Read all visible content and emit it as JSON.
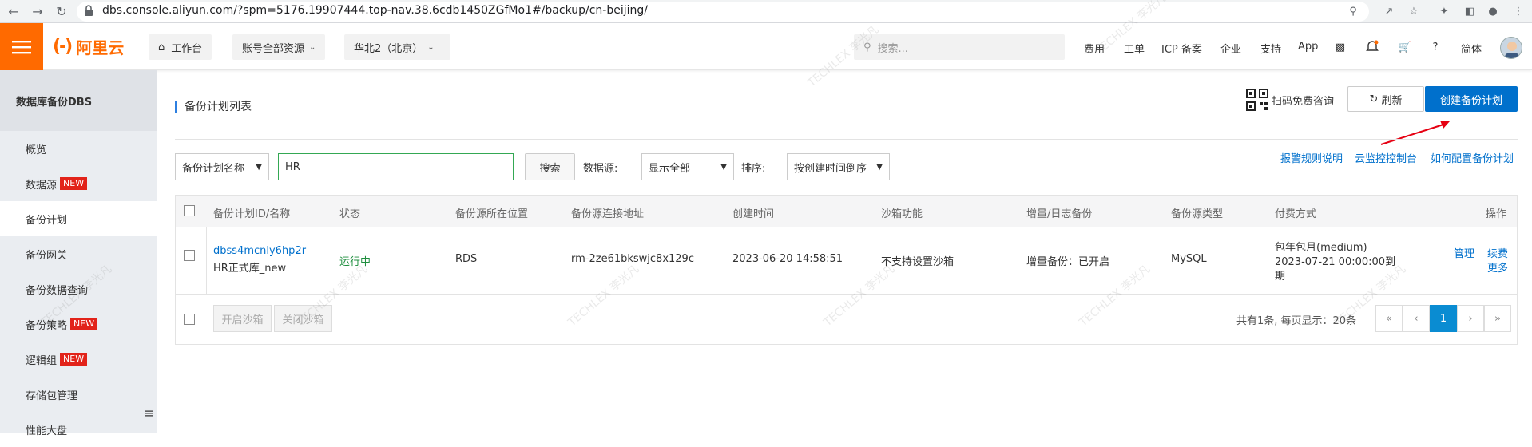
{
  "browser": {
    "url": "dbs.console.aliyun.com/?spm=5176.19907444.top-nav.38.6cdb1450ZGfMo1#/backup/cn-beijing/"
  },
  "topnav": {
    "logo_text": "阿里云",
    "logo_mark": "(-)",
    "workbench": "工作台",
    "account_resources": "账号全部资源",
    "region": "华北2（北京）",
    "search_placeholder": "搜索...",
    "links": [
      "费用",
      "工单",
      "ICP 备案",
      "企业",
      "支持",
      "App"
    ],
    "lang": "简体"
  },
  "sidebar": {
    "title": "数据库备份DBS",
    "items": [
      {
        "label": "概览",
        "badge": ""
      },
      {
        "label": "数据源",
        "badge": "NEW"
      },
      {
        "label": "备份计划",
        "badge": ""
      },
      {
        "label": "备份网关",
        "badge": ""
      },
      {
        "label": "备份数据查询",
        "badge": ""
      },
      {
        "label": "备份策略",
        "badge": "NEW"
      },
      {
        "label": "逻辑组",
        "badge": "NEW"
      },
      {
        "label": "存储包管理",
        "badge": ""
      },
      {
        "label": "性能大盘",
        "badge": ""
      }
    ]
  },
  "main": {
    "page_title": "备份计划列表",
    "qr_label": "扫码免费咨询",
    "refresh_label": "刷新",
    "create_label": "创建备份计划",
    "filter": {
      "field_select": "备份计划名称",
      "query_value": "HR",
      "search_button": "搜索",
      "source_label": "数据源:",
      "source_select": "显示全部",
      "sort_label": "排序:",
      "sort_select": "按创建时间倒序"
    },
    "help_links": [
      "报警规则说明",
      "云监控控制台",
      "如何配置备份计划"
    ],
    "table": {
      "headers": [
        "备份计划ID/名称",
        "状态",
        "备份源所在位置",
        "备份源连接地址",
        "创建时间",
        "沙箱功能",
        "增量/日志备份",
        "备份源类型",
        "付费方式",
        "操作"
      ],
      "rows": [
        {
          "id": "dbss4mcnly6hp2r",
          "name": "HR正式库_new",
          "status": "运行中",
          "location": "RDS",
          "address": "rm-2ze61bkswjc8x129c",
          "created": "2023-06-20 14:58:51",
          "sandbox": "不支持设置沙箱",
          "incremental": "增量备份：已开启",
          "type": "MySQL",
          "billing_line1": "包年包月(medium)",
          "billing_line2": "2023-07-21 00:00:00到",
          "billing_line3": "期",
          "action_manage": "管理",
          "action_renew": "续费",
          "action_more": "更多"
        }
      ],
      "footer": {
        "enable_sandbox": "开启沙箱",
        "disable_sandbox": "关闭沙箱",
        "summary": "共有1条, 每页显示：20条",
        "pager": [
          "«",
          "‹",
          "1",
          "›",
          "»"
        ]
      }
    }
  },
  "watermark": "TECHLEX 李光凡",
  "colors": {
    "brand_orange": "#ff6a00",
    "primary_blue": "#0070cc",
    "status_green": "#1e8e3e",
    "badge_red": "#e2231a"
  }
}
